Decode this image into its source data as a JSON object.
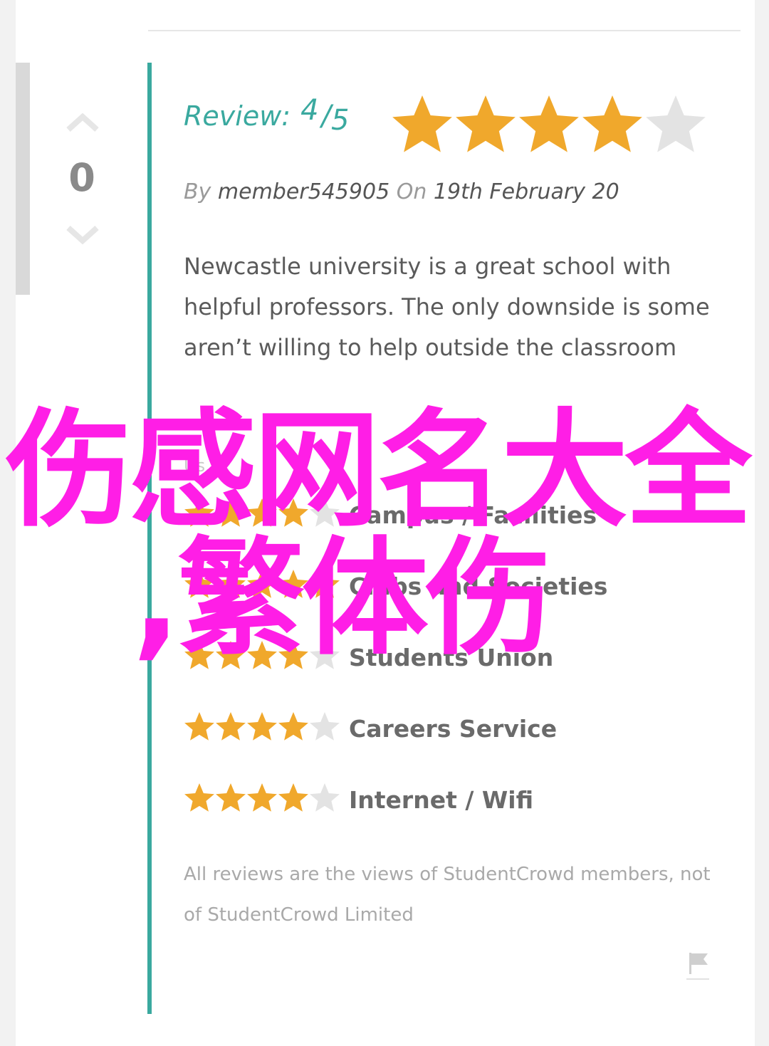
{
  "vote": {
    "count": "0",
    "up_icon": "chevron-up-icon",
    "down_icon": "chevron-down-icon"
  },
  "review": {
    "label": "Review:",
    "score": "4",
    "slash": "/",
    "out_of": "5",
    "rating": 4,
    "max_rating": 5,
    "by_label": "By",
    "author": "member545905",
    "on_label": "On",
    "date": "19th February 20",
    "body": "Newcastle university is a great school with helpful professors. The only downside is some aren’t willing to help outside the classroom",
    "faded_label": "Us..."
  },
  "ratings": [
    {
      "label": "Campus / Facilities",
      "stars": 4
    },
    {
      "label": "Clubs and Societies",
      "stars": 5
    },
    {
      "label": "Students Union",
      "stars": 4
    },
    {
      "label": "Careers Service",
      "stars": 4
    },
    {
      "label": "Internet / Wifi",
      "stars": 4
    }
  ],
  "disclaimer": "All reviews are the views of StudentCrowd members, not of StudentCrowd Limited",
  "flag_icon": "flag-icon",
  "watermark": {
    "line1": "伤感网名大全",
    "line2": ",繁体伤"
  },
  "colors": {
    "accent": "#3aa99f",
    "star_filled": "#f0a82c",
    "star_empty": "#e3e3e3",
    "watermark": "#ff1ee6"
  }
}
